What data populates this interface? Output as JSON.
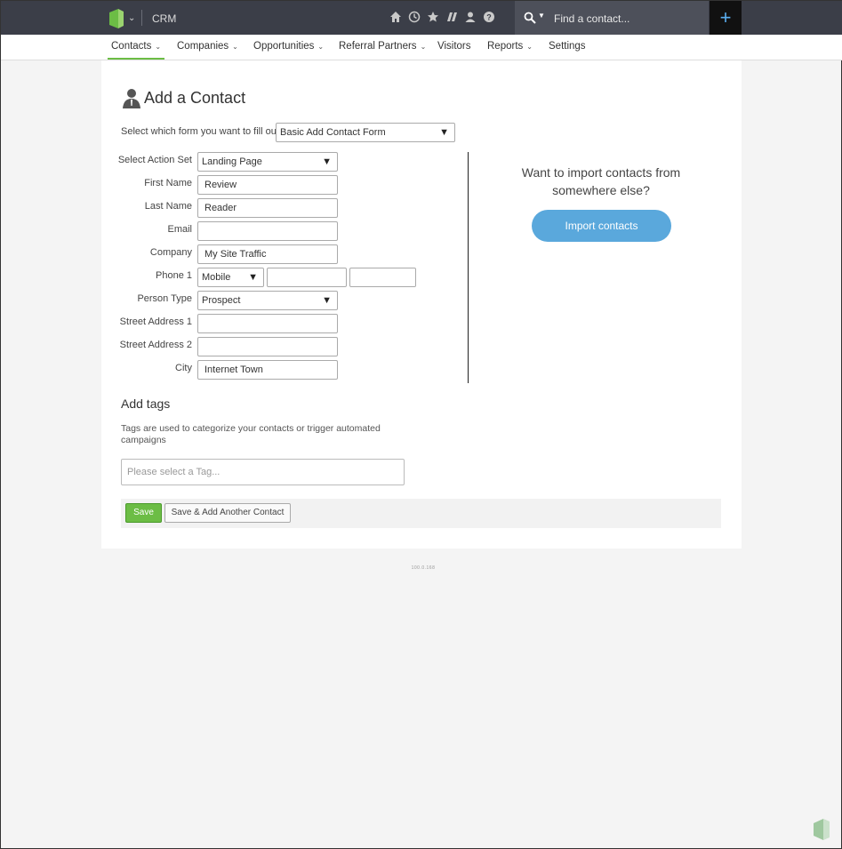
{
  "header": {
    "app_name": "CRM",
    "icons": [
      "home-icon",
      "history-icon",
      "star-icon",
      "pipeline-icon",
      "person-icon",
      "help-icon"
    ],
    "search_placeholder": "Find a contact...",
    "add_button": "+",
    "accent_color": "#6cbd45"
  },
  "nav": {
    "items": [
      {
        "label": "Contacts",
        "has_menu": true,
        "active": true
      },
      {
        "label": "Companies",
        "has_menu": true
      },
      {
        "label": "Opportunities",
        "has_menu": true
      },
      {
        "label": "Referral Partners",
        "has_menu": true
      },
      {
        "label": "Visitors",
        "has_menu": false
      },
      {
        "label": "Reports",
        "has_menu": true
      },
      {
        "label": "Settings",
        "has_menu": false
      }
    ]
  },
  "page": {
    "title": "Add a Contact",
    "form_select_label": "Select which form you want to fill out:",
    "form_select_value": "Basic Add Contact Form"
  },
  "form": {
    "action_set_label": "Select Action Set",
    "action_set_value": "Landing Page",
    "first_name_label": "First Name",
    "first_name_value": "Review",
    "last_name_label": "Last Name",
    "last_name_value": "Reader",
    "email_label": "Email",
    "email_value": "",
    "company_label": "Company",
    "company_value": "My Site Traffic",
    "phone_label": "Phone 1",
    "phone_type_value": "Mobile",
    "phone_number_value": "",
    "phone_ext_value": "",
    "person_type_label": "Person Type",
    "person_type_value": "Prospect",
    "street1_label": "Street Address 1",
    "street1_value": "",
    "street2_label": "Street Address 2",
    "street2_value": "",
    "city_label": "City",
    "city_value": "Internet Town"
  },
  "import": {
    "question": "Want to import contacts from somewhere else?",
    "button_label": "Import contacts",
    "button_color": "#5aa8dc"
  },
  "tags": {
    "title": "Add tags",
    "description": "Tags are used to categorize your contacts or trigger automated campaigns",
    "placeholder": "Please select a Tag..."
  },
  "actions": {
    "save_label": "Save",
    "save_add_label": "Save & Add Another Contact"
  },
  "footer": {
    "version": "100.0.168"
  }
}
